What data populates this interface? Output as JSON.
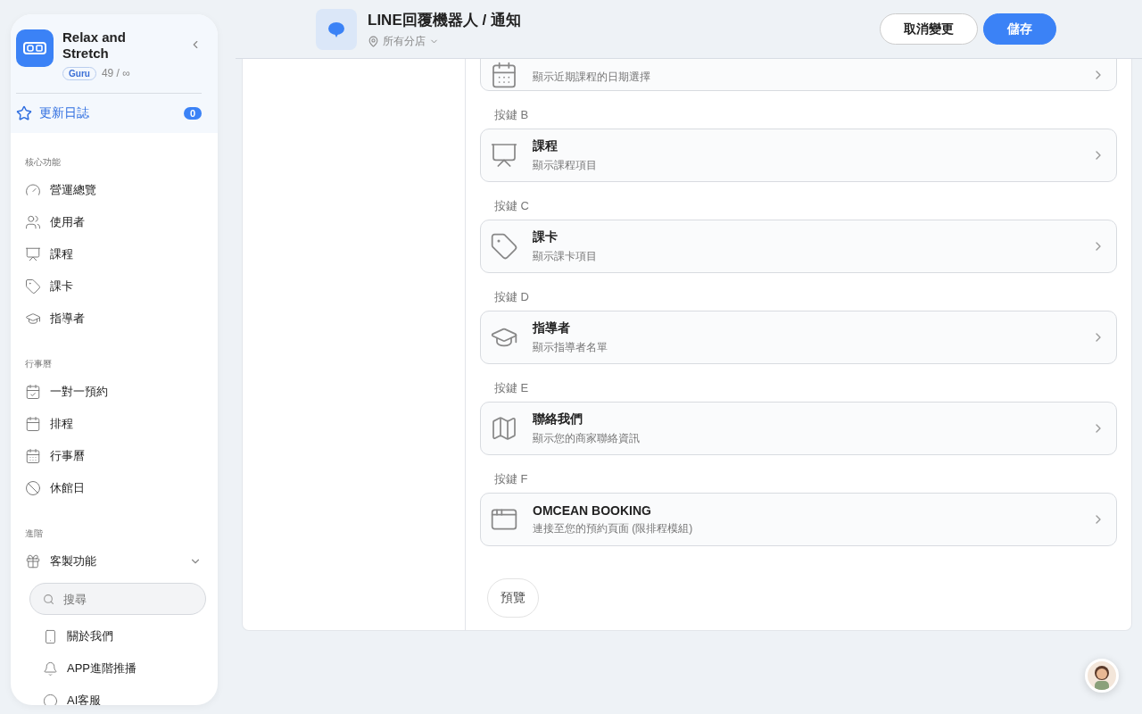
{
  "brand": {
    "name": "Relax and Stretch",
    "plan": "Guru",
    "usage": "49 / ∞"
  },
  "changelog": {
    "label": "更新日誌",
    "count": "0"
  },
  "sidebar": {
    "sections": [
      {
        "title": "核心功能",
        "items": [
          {
            "label": "營運總覽"
          },
          {
            "label": "使用者"
          },
          {
            "label": "課程"
          },
          {
            "label": "課卡"
          },
          {
            "label": "指導者"
          }
        ]
      },
      {
        "title": "行事曆",
        "items": [
          {
            "label": "一對一預約"
          },
          {
            "label": "排程"
          },
          {
            "label": "行事曆"
          },
          {
            "label": "休館日"
          }
        ]
      },
      {
        "title": "進階",
        "items": [
          {
            "label": "客製功能",
            "expanded": true
          }
        ]
      }
    ],
    "search": {
      "placeholder": "搜尋"
    },
    "sub_items": [
      {
        "label": "關於我們"
      },
      {
        "label": "APP進階推播"
      },
      {
        "label": "AI客服"
      }
    ]
  },
  "header": {
    "title": "LINE回覆機器人 / 通知",
    "branch": "所有分店",
    "buttons": [
      {
        "label": "取消變更",
        "kind": "secondary"
      },
      {
        "label": "儲存",
        "kind": "primary"
      }
    ]
  },
  "keys": [
    {
      "subtitle": "顯示近期課程的日期選擇"
    },
    {
      "heading": "按鍵 B",
      "title": "課程",
      "subtitle": "顯示課程項目"
    },
    {
      "heading": "按鍵 C",
      "title": "課卡",
      "subtitle": "顯示課卡項目"
    },
    {
      "heading": "按鍵 D",
      "title": "指導者",
      "subtitle": "顯示指導者名單"
    },
    {
      "heading": "按鍵 E",
      "title": "聯絡我們",
      "subtitle": "顯示您的商家聯絡資訊"
    },
    {
      "heading": "按鍵 F",
      "title": "OMCEAN BOOKING",
      "subtitle": "連接至您的預約頁面 (限排程模組)"
    }
  ],
  "preview_button": "預覽"
}
